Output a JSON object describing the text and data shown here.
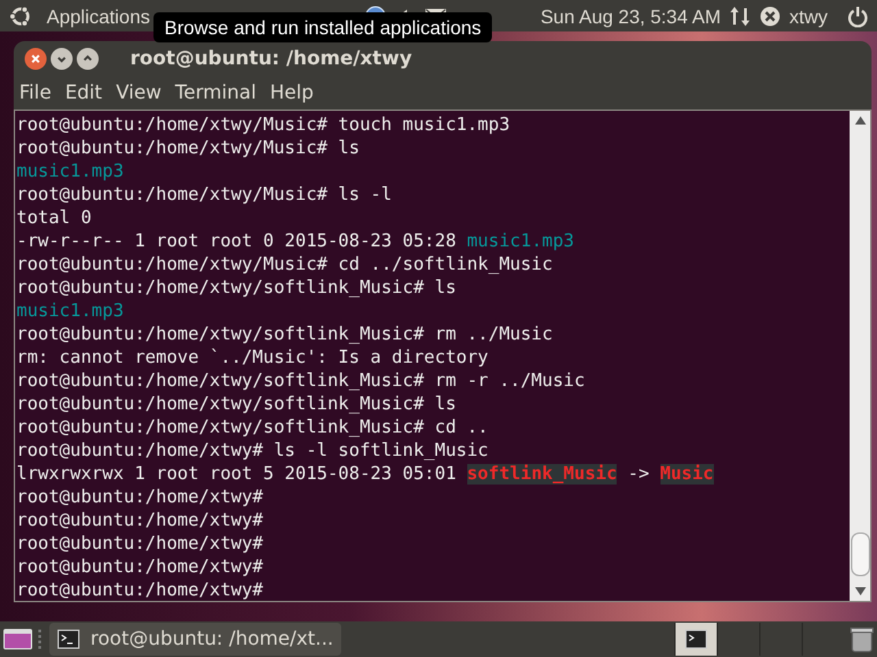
{
  "top_panel": {
    "menus": [
      "Applications"
    ],
    "clock": "Sun Aug 23,  5:34 AM",
    "user": "xtwy"
  },
  "tooltip": "Browse and run installed applications",
  "window": {
    "title": "root@ubuntu: /home/xtwy",
    "menu": [
      "File",
      "Edit",
      "View",
      "Terminal",
      "Help"
    ]
  },
  "terminal": {
    "lines": [
      [
        {
          "text": "root@ubuntu:/home/xtwy/Music# touch music1.mp3",
          "kind": "plain"
        }
      ],
      [
        {
          "text": "root@ubuntu:/home/xtwy/Music# ls",
          "kind": "plain"
        }
      ],
      [
        {
          "text": "music1.mp3",
          "kind": "file"
        }
      ],
      [
        {
          "text": "root@ubuntu:/home/xtwy/Music# ls -l",
          "kind": "plain"
        }
      ],
      [
        {
          "text": "total 0",
          "kind": "plain"
        }
      ],
      [
        {
          "text": "-rw-r--r-- 1 root root 0 2015-08-23 05:28 ",
          "kind": "plain"
        },
        {
          "text": "music1.mp3",
          "kind": "file"
        }
      ],
      [
        {
          "text": "root@ubuntu:/home/xtwy/Music# cd ../softlink_Music",
          "kind": "plain"
        }
      ],
      [
        {
          "text": "root@ubuntu:/home/xtwy/softlink_Music# ls",
          "kind": "plain"
        }
      ],
      [
        {
          "text": "music1.mp3",
          "kind": "file"
        }
      ],
      [
        {
          "text": "root@ubuntu:/home/xtwy/softlink_Music# rm ../Music",
          "kind": "plain"
        }
      ],
      [
        {
          "text": "rm: cannot remove `../Music': Is a directory",
          "kind": "plain"
        }
      ],
      [
        {
          "text": "root@ubuntu:/home/xtwy/softlink_Music# rm -r ../Music",
          "kind": "plain"
        }
      ],
      [
        {
          "text": "root@ubuntu:/home/xtwy/softlink_Music# ls",
          "kind": "plain"
        }
      ],
      [
        {
          "text": "root@ubuntu:/home/xtwy/softlink_Music# cd ..",
          "kind": "plain"
        }
      ],
      [
        {
          "text": "root@ubuntu:/home/xtwy# ls -l softlink_Music",
          "kind": "plain"
        }
      ],
      [
        {
          "text": "lrwxrwxrwx 1 root root 5 2015-08-23 05:01 ",
          "kind": "plain"
        },
        {
          "text": "softlink_Music",
          "kind": "broken"
        },
        {
          "text": " -> ",
          "kind": "plain"
        },
        {
          "text": "Music",
          "kind": "broken"
        }
      ],
      [
        {
          "text": "root@ubuntu:/home/xtwy#",
          "kind": "plain"
        }
      ],
      [
        {
          "text": "root@ubuntu:/home/xtwy#",
          "kind": "plain"
        }
      ],
      [
        {
          "text": "root@ubuntu:/home/xtwy#",
          "kind": "plain"
        }
      ],
      [
        {
          "text": "root@ubuntu:/home/xtwy#",
          "kind": "plain"
        }
      ],
      [
        {
          "text": "root@ubuntu:/home/xtwy#",
          "kind": "plain"
        }
      ]
    ]
  },
  "taskbar": {
    "task": "root@ubuntu: /home/xt..."
  }
}
